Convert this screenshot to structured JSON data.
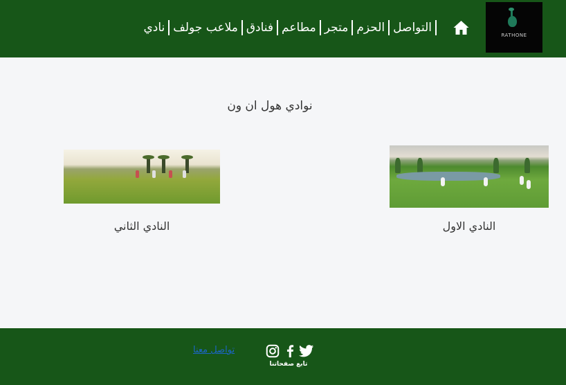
{
  "header": {
    "logo_text": "RATHONE",
    "nav": [
      "التواصل",
      "الحزم",
      "متجر",
      "مطاعم",
      "فنادق",
      "ملاعب جولف",
      "نادي"
    ],
    "colors": {
      "background": "#175618",
      "text": "#ffffff"
    },
    "home_icon": "home-icon"
  },
  "main": {
    "heading": "نوادي هول ان ون",
    "cards": [
      {
        "caption": "النادي الاول",
        "image": "golf-course-photo"
      },
      {
        "caption": "النادي الثاني",
        "image": "golf-course-photo"
      }
    ]
  },
  "footer": {
    "contact_link": "تواصل معنا",
    "follow_label": "تابع صفحاتنا",
    "social_icons": [
      "twitter-icon",
      "facebook-icon",
      "instagram-icon"
    ],
    "colors": {
      "background": "#175618",
      "link": "#1c66c8"
    }
  }
}
